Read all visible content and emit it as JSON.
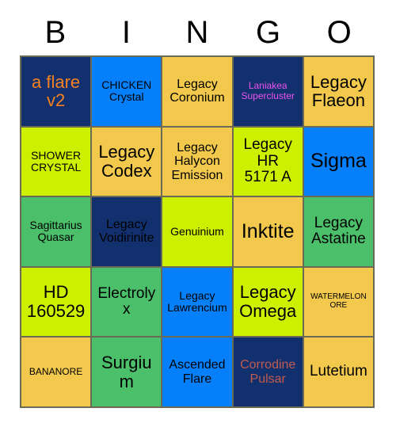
{
  "card": {
    "title": "BINGO",
    "header_letters": [
      "B",
      "I",
      "N",
      "G",
      "O"
    ]
  },
  "palette": {
    "navy": "#12306E",
    "blue": "#0580FA",
    "gold": "#F2C94C",
    "lime": "#CCF000",
    "green": "#4CBF6A",
    "text_dark": "#000000",
    "text_orange": "#F58220",
    "text_magenta": "#EE52EE",
    "text_brick": "#C15B4E",
    "grid_line": "#6b6b55",
    "page_background": "#FFFFFF"
  },
  "grid": {
    "columns": 5,
    "rows": 5,
    "cells": [
      {
        "text": "a flare\nv2",
        "bg": "#12306E",
        "fg": "#F58220",
        "size": "xl"
      },
      {
        "text": "CHICKEN\nCrystal",
        "bg": "#0580FA",
        "fg": "#000000",
        "size": "sm"
      },
      {
        "text": "Legacy\nCoronium",
        "bg": "#F2C94C",
        "fg": "#000000",
        "size": "md"
      },
      {
        "text": "Laniakea\nSupercluster",
        "bg": "#12306E",
        "fg": "#EE52EE",
        "size": "xs"
      },
      {
        "text": "Legacy\nFlaeon",
        "bg": "#F2C94C",
        "fg": "#000000",
        "size": "xl"
      },
      {
        "text": "SHOWER\nCRYSTAL",
        "bg": "#CCF000",
        "fg": "#000000",
        "size": "sm"
      },
      {
        "text": "Legacy\nCodex",
        "bg": "#F2C94C",
        "fg": "#000000",
        "size": "xl"
      },
      {
        "text": "Legacy\nHalycon\nEmission",
        "bg": "#F2C94C",
        "fg": "#000000",
        "size": "md"
      },
      {
        "text": "Legacy\nHR\n5171 A",
        "bg": "#CCF000",
        "fg": "#000000",
        "size": "lg"
      },
      {
        "text": "Sigma",
        "bg": "#0580FA",
        "fg": "#000000",
        "size": "xxl"
      },
      {
        "text": "Sagittarius\nQuasar",
        "bg": "#4CBF6A",
        "fg": "#000000",
        "size": "sm"
      },
      {
        "text": "Legacy\nVoidirinite",
        "bg": "#12306E",
        "fg": "#000000",
        "size": "md"
      },
      {
        "text": "Genuinium",
        "bg": "#CCF000",
        "fg": "#000000",
        "size": "sm"
      },
      {
        "text": "Inktite",
        "bg": "#F2C94C",
        "fg": "#000000",
        "size": "xxl"
      },
      {
        "text": "Legacy\nAstatine",
        "bg": "#4CBF6A",
        "fg": "#000000",
        "size": "lg"
      },
      {
        "text": "HD\n160529",
        "bg": "#CCF000",
        "fg": "#000000",
        "size": "xl"
      },
      {
        "text": "Electrolyx",
        "bg": "#4CBF6A",
        "fg": "#000000",
        "size": "lg"
      },
      {
        "text": "Legacy\nLawrencium",
        "bg": "#0580FA",
        "fg": "#000000",
        "size": "sm"
      },
      {
        "text": "Legacy\nOmega",
        "bg": "#CCF000",
        "fg": "#000000",
        "size": "xl"
      },
      {
        "text": "WATERMELON\nORE",
        "bg": "#F2C94C",
        "fg": "#000000",
        "size": "xxs"
      },
      {
        "text": "BANANORE",
        "bg": "#F2C94C",
        "fg": "#000000",
        "size": "xs"
      },
      {
        "text": "Surgium",
        "bg": "#4CBF6A",
        "fg": "#000000",
        "size": "xl"
      },
      {
        "text": "Ascended\nFlare",
        "bg": "#0580FA",
        "fg": "#000000",
        "size": "md"
      },
      {
        "text": "Corrodine\nPulsar",
        "bg": "#12306E",
        "fg": "#C15B4E",
        "size": "md"
      },
      {
        "text": "Lutetium",
        "bg": "#F2C94C",
        "fg": "#000000",
        "size": "lg"
      }
    ]
  }
}
